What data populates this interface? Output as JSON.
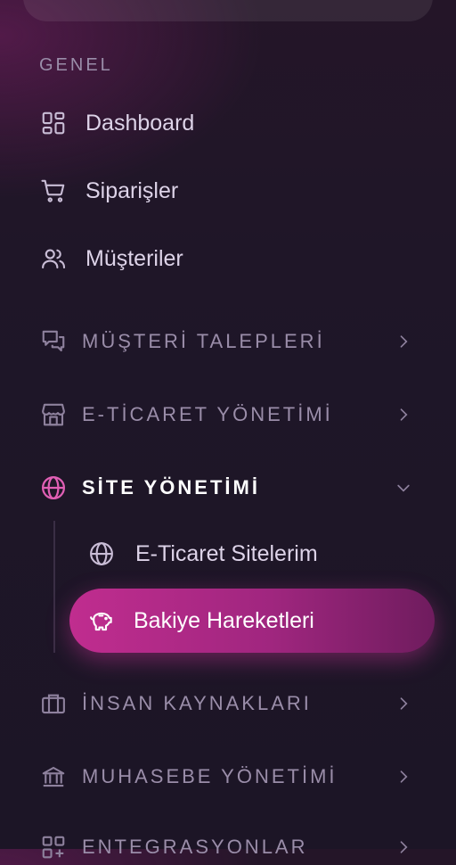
{
  "sidebar": {
    "section_general": "GENEL",
    "items": [
      {
        "label": "Dashboard",
        "icon": "dashboard-grid-icon"
      },
      {
        "label": "Siparişler",
        "icon": "shopping-cart-icon"
      },
      {
        "label": "Müşteriler",
        "icon": "users-icon"
      }
    ],
    "groups": [
      {
        "label": "MÜŞTERİ TALEPLERİ",
        "icon": "chat-bubbles-icon",
        "expanded": false
      },
      {
        "label": "E-TİCARET YÖNETİMİ",
        "icon": "storefront-icon",
        "expanded": false
      },
      {
        "label": "SİTE YÖNETİMİ",
        "icon": "globe-icon",
        "expanded": true,
        "children": [
          {
            "label": "E-Ticaret Sitelerim",
            "icon": "globe-icon",
            "active": false
          },
          {
            "label": "Bakiye Hareketleri",
            "icon": "piggy-bank-icon",
            "active": true
          }
        ]
      },
      {
        "label": "İNSAN KAYNAKLARI",
        "icon": "briefcase-icon",
        "expanded": false
      },
      {
        "label": "MUHASEBE YÖNETİMİ",
        "icon": "bank-icon",
        "expanded": false
      },
      {
        "label": "ENTEGRASYONLAR",
        "icon": "grid-plus-icon",
        "expanded": false
      }
    ]
  },
  "colors": {
    "accent": "#c02d8f",
    "accent_dark": "#6f1c5e",
    "text_primary": "#ddd3e8",
    "text_muted": "#9a8da9",
    "background": "#1f1628"
  }
}
